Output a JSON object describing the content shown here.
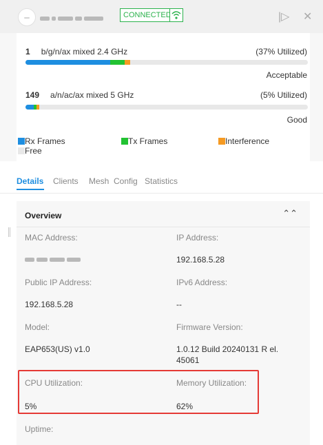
{
  "header": {
    "status_badge": "CONNECTED",
    "icons": {
      "device": "access-point-icon",
      "wifi": "wifi-icon",
      "expand": "expand-panel-icon",
      "close": "close-icon"
    },
    "expand_glyph": "|▷",
    "close_glyph": "✕",
    "colors": {
      "connected": "#2bb24c"
    }
  },
  "radios": [
    {
      "channel": "1",
      "mode": "b/g/n/ax mixed  2.4 GHz",
      "utilization": "(37% Utilized)",
      "status": "Acceptable",
      "rx_fraction": 0.3,
      "tx_fraction": 0.05,
      "interference_fraction": 0.02
    },
    {
      "channel": "149",
      "mode": "a/n/ac/ax mixed  5 GHz",
      "utilization": "(5% Utilized)",
      "status": "Good",
      "rx_fraction": 0.03,
      "tx_fraction": 0.01,
      "interference_fraction": 0.01
    }
  ],
  "legend": {
    "rx": "Rx Frames",
    "tx": "Tx Frames",
    "interference": "Interference",
    "free": "Free",
    "colors": {
      "rx": "#1e8ee0",
      "tx": "#22c232",
      "interference": "#f59a23",
      "free": "#e8e8e8"
    }
  },
  "tabs": [
    "Details",
    "Clients",
    "Mesh",
    "Config",
    "Statistics"
  ],
  "active_tab": "Details",
  "overview": {
    "title": "Overview",
    "collapse_glyph": "⌃⌃",
    "fields": {
      "mac_label": "MAC Address:",
      "ip_label": "IP Address:",
      "ip_value": "192.168.5.28",
      "public_ip_label": "Public IP Address:",
      "public_ip_value": "192.168.5.28",
      "ipv6_label": "IPv6 Address:",
      "ipv6_value": "--",
      "model_label": "Model:",
      "model_value": "EAP653(US) v1.0",
      "firmware_label": "Firmware Version:",
      "firmware_value": "1.0.12 Build 20240131 R el. 45061",
      "cpu_label": "CPU Utilization:",
      "cpu_value": "5%",
      "memory_label": "Memory Utilization:",
      "memory_value": "62%",
      "uptime_label": "Uptime:"
    }
  },
  "annotation_color": "#e53935"
}
